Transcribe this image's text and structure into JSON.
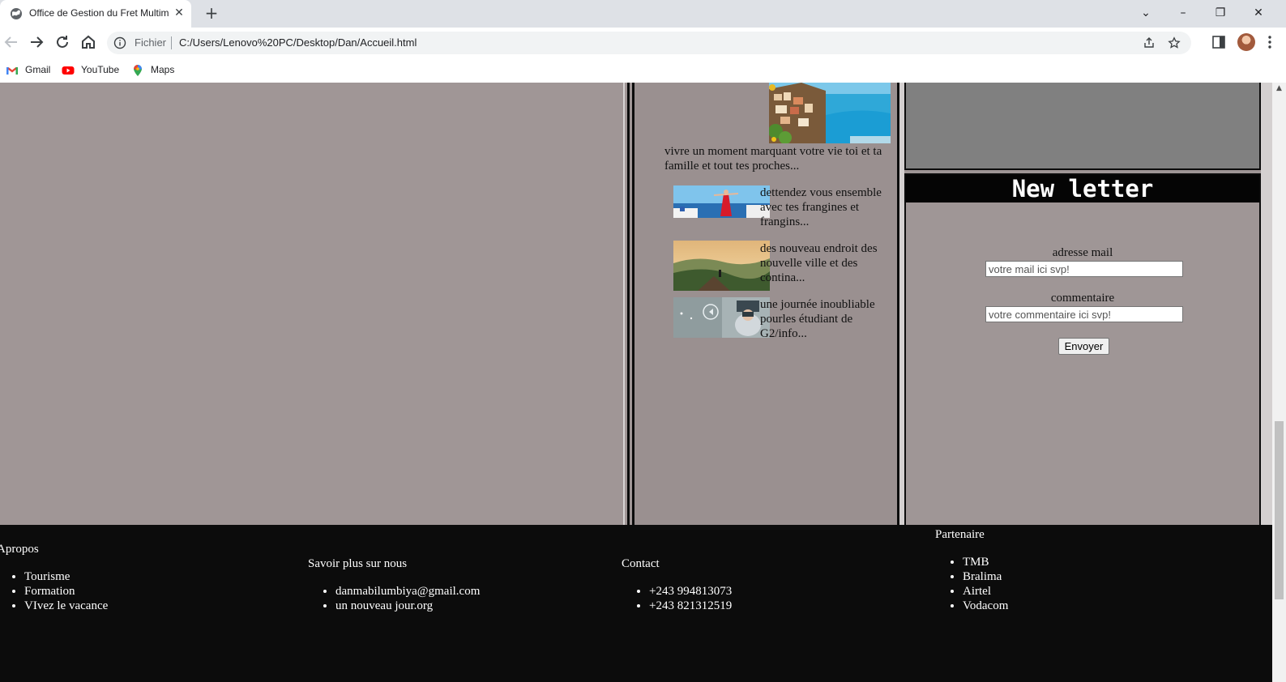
{
  "browser": {
    "tab_title": "Office de Gestion du Fret Multim",
    "url_scheme": "Fichier",
    "url": "C:/Users/Lenovo%20PC/Desktop/Dan/Accueil.html",
    "bookmarks": [
      "Gmail",
      "YouTube",
      "Maps"
    ]
  },
  "articles": {
    "hero_caption": "vivre un moment marquant votre vie toi et ta famille et tout tes proches...",
    "items": [
      "dettendez vous ensemble avec tes frangines et frangins...",
      "des nouveau endroit des nouvelle ville et des contina...",
      "une journée inoubliable pourles étudiant de G2/info..."
    ]
  },
  "newsletter": {
    "title": "New letter",
    "email_label": "adresse mail",
    "email_placeholder": "votre mail ici svp!",
    "comment_label": "commentaire",
    "comment_placeholder": "votre commentaire ici svp!",
    "submit_label": "Envoyer"
  },
  "footer": {
    "apropos": {
      "heading": "Apropos",
      "items": [
        "Tourisme",
        "Formation",
        "VIvez le vacance"
      ]
    },
    "savoir": {
      "heading": "Savoir plus sur nous",
      "items": [
        "danmabilumbiya@gmail.com",
        "un nouveau jour.org"
      ]
    },
    "contact": {
      "heading": "Contact",
      "items": [
        "+243 994813073",
        "+243 821312519"
      ]
    },
    "partenaire": {
      "heading": "Partenaire",
      "items": [
        "TMB",
        "Bralima",
        "Airtel",
        "Vodacom"
      ]
    }
  }
}
